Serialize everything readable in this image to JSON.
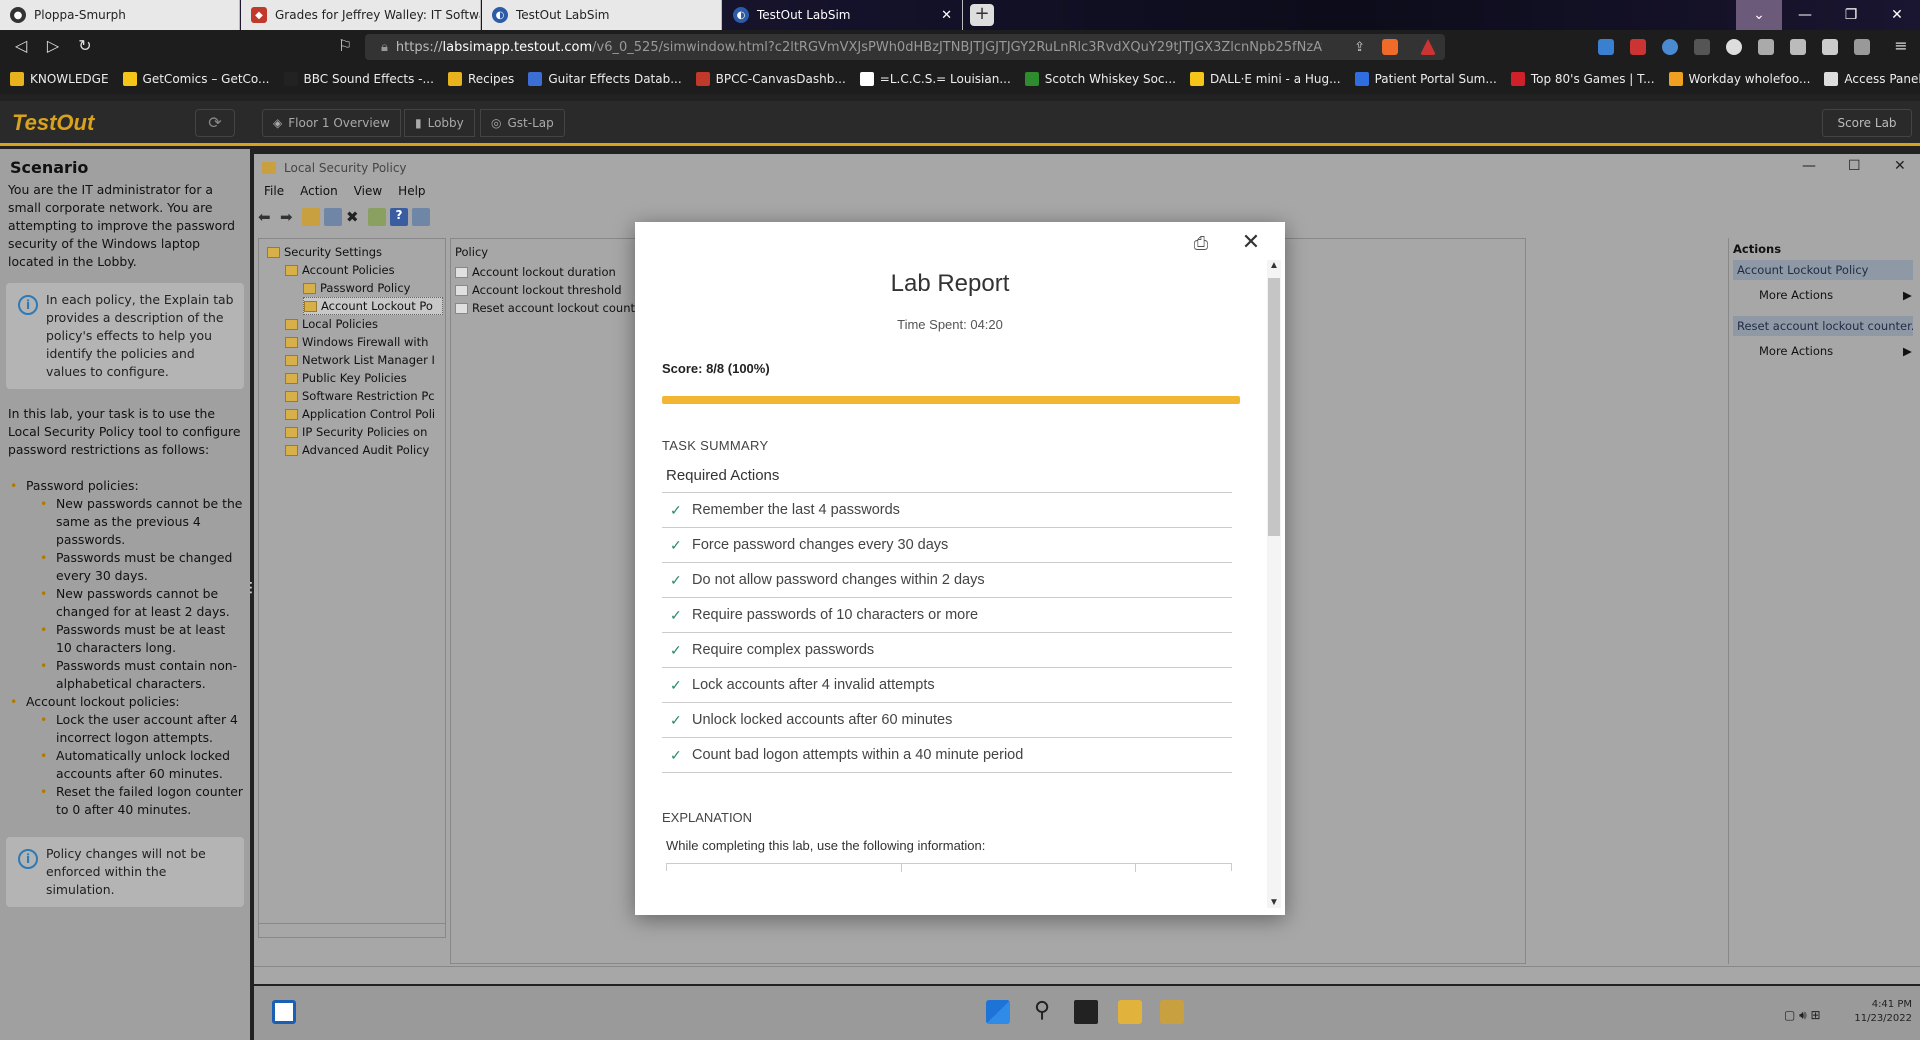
{
  "browser": {
    "tabs": [
      {
        "label": "Ploppa-Smurph",
        "icon": "github-icon",
        "color": "#333333"
      },
      {
        "label": "Grades for Jeffrey Walley: IT Software",
        "icon": "canvas-icon",
        "color": "#c0392b"
      },
      {
        "label": "TestOut LabSim",
        "icon": "testout-icon",
        "color": "#2c5ba8"
      },
      {
        "label": "TestOut LabSim",
        "icon": "testout-icon",
        "color": "#2c5ba8",
        "active": true
      }
    ],
    "url_host": "labsimapp.testout.com",
    "url_path": "/v6_0_525/simwindow.html?c2ltRGVmVXJsPWh0dHBzJTNBJTJGJTJGY2RuLnRlc3RvdXQuY29tJTJGX3ZlcnNpb25fNzAyOSU...",
    "url_scheme": "https://"
  },
  "bookmarks": [
    {
      "label": "KNOWLEDGE",
      "color": "#e8b21c"
    },
    {
      "label": "GetComics – GetCo...",
      "color": "#f5c518"
    },
    {
      "label": "BBC Sound Effects -...",
      "color": "#222222"
    },
    {
      "label": "Recipes",
      "color": "#e8b21c"
    },
    {
      "label": "Guitar Effects Datab...",
      "color": "#3b6fd6"
    },
    {
      "label": "BPCC-CanvasDashb...",
      "color": "#c0392b"
    },
    {
      "label": "=L.C.C.S.= Louisian...",
      "color": "#ffffff"
    },
    {
      "label": "Scotch Whiskey Soc...",
      "color": "#2e8b2e"
    },
    {
      "label": "DALL·E mini - a Hug...",
      "color": "#f5c518"
    },
    {
      "label": "Patient Portal Sum...",
      "color": "#2f6ee0"
    },
    {
      "label": "Top 80's Games | T...",
      "color": "#d0202a"
    },
    {
      "label": "Workday wholefoo...",
      "color": "#f0a020"
    },
    {
      "label": "Access Panel Applic...",
      "color": "#dddddd"
    }
  ],
  "testout": {
    "logo": "TestOut",
    "crumbs": [
      "Floor 1 Overview",
      "Lobby",
      "Gst-Lap"
    ],
    "score_lab": "Score Lab"
  },
  "scenario": {
    "title": "Scenario",
    "intro": "You are the IT administrator for a small corporate network. You are attempting to improve the password security of the Windows laptop located in the Lobby.",
    "info1": "In each policy, the Explain tab provides a description of the policy's effects to help you identify the policies and values to configure.",
    "task": "In this lab, your task is to use the Local Security Policy tool to configure password restrictions as follows:",
    "groups": [
      {
        "title": "Password policies:",
        "items": [
          "New passwords cannot be the same as the previous 4 passwords.",
          "Passwords must be changed every 30 days.",
          "New passwords cannot be changed for at least 2 days.",
          "Passwords must be at least 10 characters long.",
          "Passwords must contain non-alphabetical characters."
        ]
      },
      {
        "title": "Account lockout policies:",
        "items": [
          "Lock the user account after 4 incorrect logon attempts.",
          "Automatically unlock locked accounts after 60 minutes.",
          "Reset the failed logon counter to 0 after 40 minutes."
        ]
      }
    ],
    "info2": "Policy changes will not be enforced within the simulation."
  },
  "mmc": {
    "title": "Local Security Policy",
    "menu": [
      "File",
      "Action",
      "View",
      "Help"
    ],
    "tree": [
      {
        "label": "Security Settings",
        "level": 0
      },
      {
        "label": "Account Policies",
        "level": 1
      },
      {
        "label": "Password Policy",
        "level": 2
      },
      {
        "label": "Account Lockout Po",
        "level": 2,
        "selected": true
      },
      {
        "label": "Local Policies",
        "level": 1
      },
      {
        "label": "Windows Firewall with",
        "level": 1
      },
      {
        "label": "Network List Manager I",
        "level": 1
      },
      {
        "label": "Public Key Policies",
        "level": 1
      },
      {
        "label": "Software Restriction Pc",
        "level": 1
      },
      {
        "label": "Application Control Poli",
        "level": 1
      },
      {
        "label": "IP Security Policies on",
        "level": 1
      },
      {
        "label": "Advanced Audit Policy",
        "level": 1
      }
    ],
    "list_header": "Policy",
    "list_items": [
      "Account lockout duration",
      "Account lockout threshold",
      "Reset account lockout counter"
    ],
    "actions_title": "Actions",
    "action_groups": [
      {
        "head": "Account Lockout Policy",
        "item": "More Actions"
      },
      {
        "head": "Reset account lockout counter...",
        "item": "More Actions"
      }
    ]
  },
  "taskbar": {
    "time": "4:41 PM",
    "date": "11/23/2022"
  },
  "report": {
    "title": "Lab Report",
    "time_spent": "Time Spent: 04:20",
    "score": "Score: 8/8 (100%)",
    "progress": 1.0,
    "task_summary": "TASK SUMMARY",
    "required_actions": "Required Actions",
    "tasks": [
      "Remember the last 4 passwords",
      "Force password changes every 30 days",
      "Do not allow password changes within 2 days",
      "Require passwords of 10 characters or more",
      "Require complex passwords",
      "Lock accounts after 4 invalid attempts",
      "Unlock locked accounts after 60 minutes",
      "Count bad logon attempts within a 40 minute period"
    ],
    "explanation": "EXPLANATION",
    "explanation_text": "While completing this lab, use the following information:"
  }
}
